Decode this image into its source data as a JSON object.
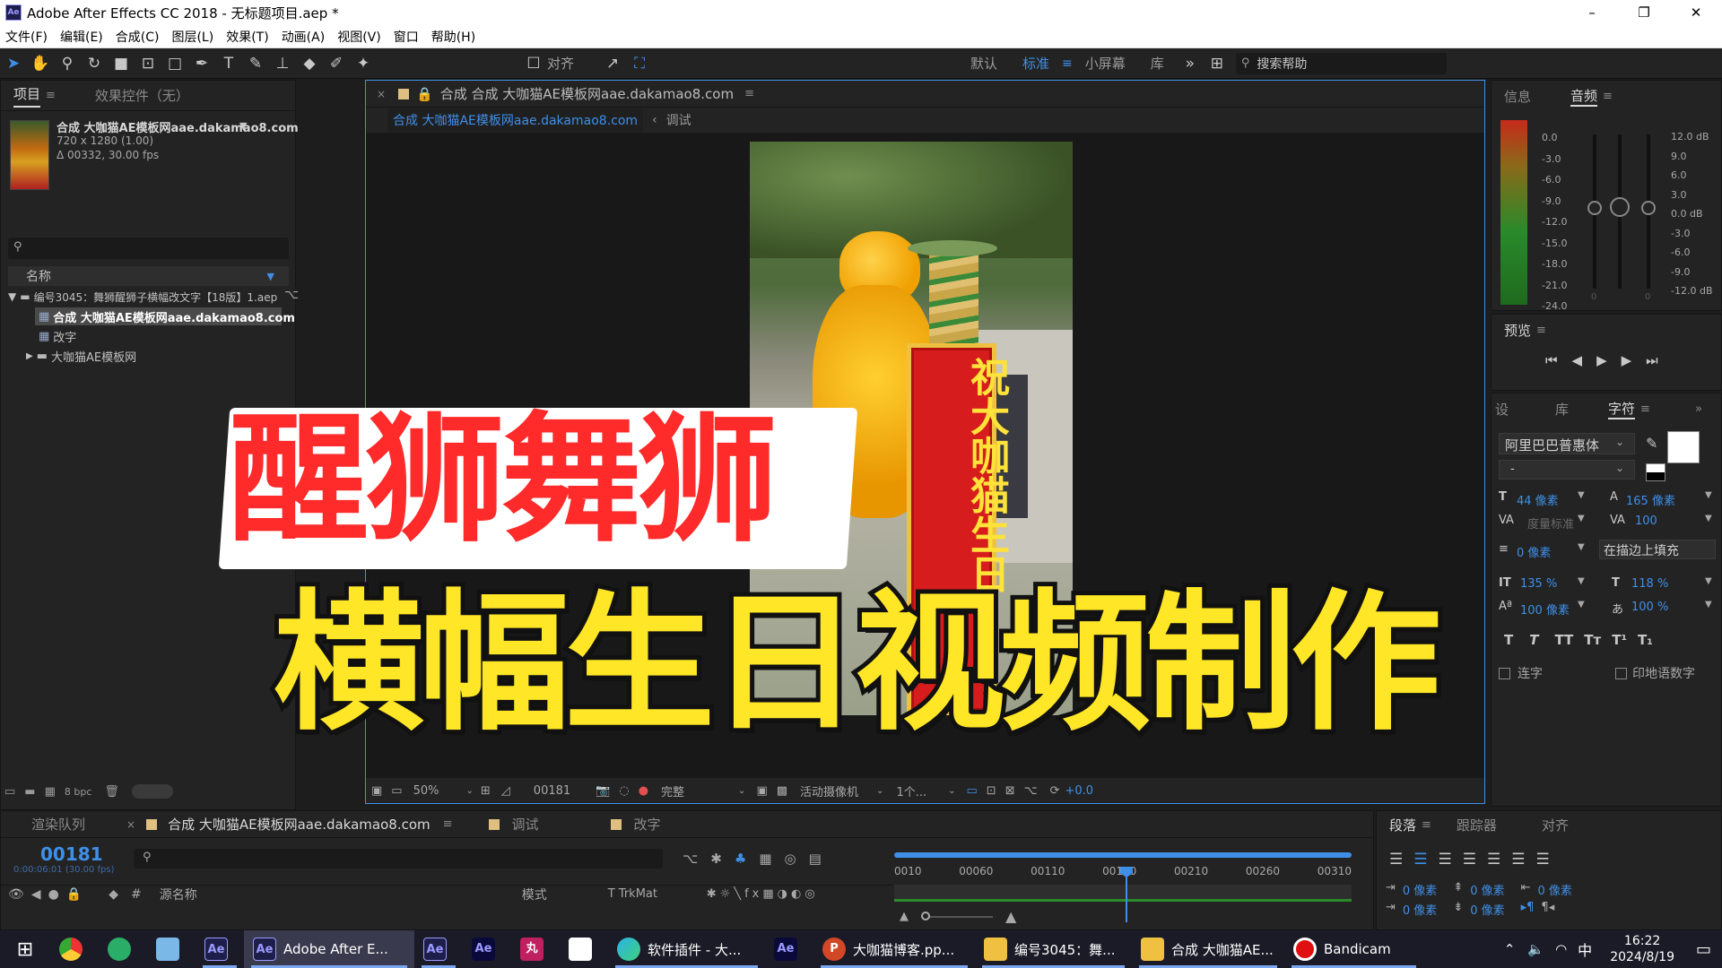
{
  "window": {
    "title": "Adobe After Effects CC 2018 - 无标题项目.aep *",
    "app_icon": "Ae",
    "min": "–",
    "max": "❐",
    "close": "✕"
  },
  "menu": [
    "文件(F)",
    "编辑(E)",
    "合成(C)",
    "图层(L)",
    "效果(T)",
    "动画(A)",
    "视图(V)",
    "窗口",
    "帮助(H)"
  ],
  "toolbar": {
    "align_label": "对齐",
    "workspaces": [
      "默认",
      "标准",
      "小屏幕",
      "库"
    ],
    "active_workspace": "标准",
    "search_placeholder": "搜索帮助"
  },
  "project": {
    "tab": "项目",
    "effects_tab": "效果控件（无）",
    "comp_name": "合成 大咖猫AE模板网aae.dakamao8.com",
    "comp_info1": "720 x 1280 (1.00)",
    "comp_info2": "Δ 00332, 30.00 fps",
    "search_placeholder": "",
    "col_name": "名称",
    "tree": [
      "编号3045：舞狮醒狮子横幅改文字【18版】1.aep",
      "合成 大咖猫AE模板网aae.dakamao8.com",
      "改字",
      "大咖猫AE模板网"
    ],
    "bpc": "8 bpc"
  },
  "composition": {
    "tab": "合成 合成 大咖猫AE模板网aae.dakamao8.com",
    "sub_tab_active": "合成 大咖猫AE模板网aae.dakamao8.com",
    "sub_tab2": "调试",
    "banner_text": "祝大咖猫生日",
    "zoom": "50%",
    "timecode": "00181",
    "quality": "完整",
    "camera": "活动摄像机",
    "views": "1个...",
    "exposure": "+0.0"
  },
  "overlay": {
    "line1": "醒狮舞狮",
    "line2": "横幅生日视频制作"
  },
  "info": {
    "tab_info": "信息",
    "tab_audio": "音频",
    "db_left": [
      "0.0",
      "-3.0",
      "-6.0",
      "-9.0",
      "-12.0",
      "-15.0",
      "-18.0",
      "-21.0",
      "-24.0"
    ],
    "db_right": [
      "12.0 dB",
      "9.0",
      "6.0",
      "3.0",
      "0.0 dB",
      "-3.0",
      "-6.0",
      "-9.0",
      "-12.0 dB"
    ],
    "zero_left": "0",
    "zero_right": "0"
  },
  "preview": {
    "tab": "预览"
  },
  "character": {
    "tab1": "设",
    "tab2": "库",
    "tab3": "字符",
    "font": "阿里巴巴普惠体",
    "style": "-",
    "size": "44 像素",
    "leading": "165 像素",
    "kerning": "度量标准",
    "tracking": "100",
    "stroke": "0 像素",
    "stroke_mode": "在描边上填充",
    "vscale": "135 %",
    "hscale": "118 %",
    "baseline": "100 像素",
    "tsume": "100 %",
    "ligature": "连字",
    "hindi": "印地语数字",
    "styles": [
      "T",
      "T",
      "TT",
      "Tт",
      "T¹",
      "T₁"
    ]
  },
  "timeline": {
    "tab_render": "渲染队列",
    "tab_comp": "合成 大咖猫AE模板网aae.dakamao8.com",
    "tab_debug": "调试",
    "tab_edit": "改字",
    "timecode": "00181",
    "timecode_sub": "0:00:06:01 (30.00 fps)",
    "col_source": "源名称",
    "col_mode": "模式",
    "col_trk": "T  TrkMat",
    "ruler": [
      "0010",
      "00060",
      "00110",
      "00160",
      "00210",
      "00260",
      "00310"
    ]
  },
  "paragraph": {
    "tab1": "段落",
    "tab2": "跟踪器",
    "tab3": "对齐",
    "v1": "0 像素",
    "v2": "0 像素",
    "v3": "0 像素",
    "v4": "0 像素",
    "v5": "0 像素"
  },
  "taskbar": {
    "items": [
      {
        "label": "",
        "icon": "chrome"
      },
      {
        "label": "",
        "icon": "wechat"
      },
      {
        "label": "",
        "icon": "files"
      },
      {
        "label": "",
        "icon": "Ae"
      },
      {
        "label": "Adobe After E...",
        "icon": "Ae"
      },
      {
        "label": "",
        "icon": "Ae"
      },
      {
        "label": "",
        "icon": "Ae"
      },
      {
        "label": "",
        "icon": "丸"
      },
      {
        "label": "",
        "icon": "paint"
      },
      {
        "label": "软件插件 - 大...",
        "icon": "edge"
      },
      {
        "label": "",
        "icon": "Ae"
      },
      {
        "label": "大咖猫博客.pp...",
        "icon": "P"
      },
      {
        "label": "编号3045：舞...",
        "icon": "folder"
      },
      {
        "label": "合成 大咖猫AE...",
        "icon": "folder"
      },
      {
        "label": "Bandicam",
        "icon": "rec"
      }
    ],
    "time": "16:22",
    "date": "2024/8/19",
    "ime": "中"
  }
}
